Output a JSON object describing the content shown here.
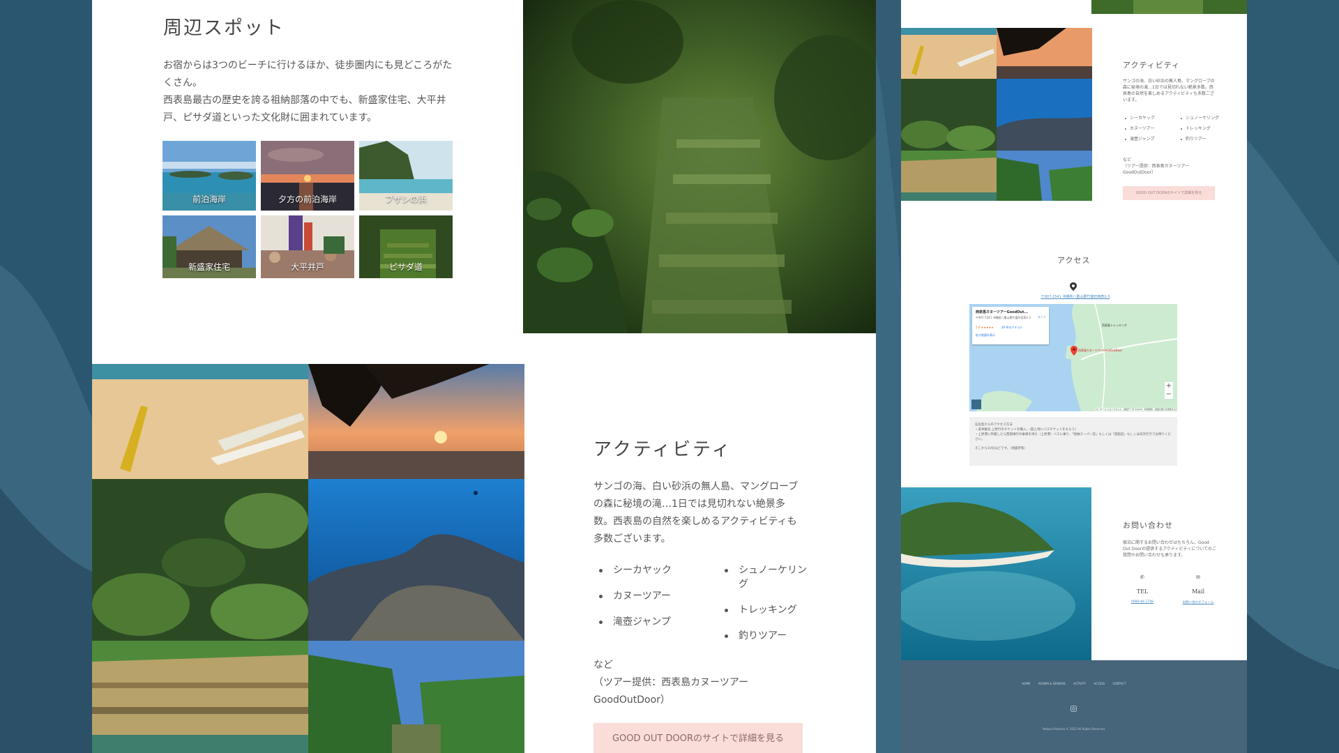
{
  "left": {
    "spots": {
      "title": "周辺スポット",
      "text1": "お宿からは3つのビーチに行けるほか、徒歩圏内にも見どころがたくさん。",
      "text2": "西表島最古の歴史を誇る祖納部落の中でも、新盛家住宅、大平井戸、ピサダ道といった文化財に囲まれています。",
      "thumbs": [
        "前泊海岸",
        "夕方の前泊海岸",
        "ブザシの浜",
        "新盛家住宅",
        "大平井戸",
        "ピサダ道"
      ]
    },
    "activity": {
      "title": "アクティビティ",
      "text": "サンゴの海、白い砂浜の無人島、マングローブの森に秘境の滝…1日では見切れない絶景多数。西表島の自然を楽しめるアクティビティも多数ございます。",
      "list_left": [
        "シーカヤック",
        "カヌーツアー",
        "滝壺ジャンプ"
      ],
      "list_right": [
        "シュノーケリング",
        "トレッキング",
        "釣りツアー"
      ],
      "note1": "など",
      "note2": "（ツアー提供：西表島カヌーツアーGoodOutDoor）",
      "button": "GOOD OUT DOORのサイトで詳細を見る"
    }
  },
  "right": {
    "activity": {
      "title": "アクティビティ",
      "text": "サンゴの海、白い砂浜の無人島、マングローブの森に秘境の滝…1日では見切れない絶景多数。西表島の自然を楽しめるアクティビティも多数ございます。",
      "list_left": [
        "シーカヤック",
        "カヌーツアー",
        "滝壺ジャンプ"
      ],
      "list_right": [
        "シュノーケリング",
        "トレッキング",
        "釣りツアー"
      ],
      "note1": "など",
      "note2": "（ツアー提供：西表島カヌーツアーGoodOutDoor）",
      "button": "GOOD OUT DOORのサイトで詳細を見る"
    },
    "access": {
      "title": "アクセス",
      "address_link": "〒907-1541 沖縄県八重山郡竹富町西表2-3",
      "map_card_title": "西表島カヌーツアーGoodOut...",
      "map_card_addr": "〒907-1541 沖縄県八重山郡竹富町西表2-3",
      "map_card_rating": "5.0 ★★★★★",
      "map_card_reviews": "26 件のクチコミ",
      "map_card_link": "拡大地図を表示",
      "map_card_route": "ルート",
      "map_label_1": "西表島カヌーツアーGoodOutDoor",
      "map_label_2": "西表島トレッキング",
      "map_footer": "キーボード ショートカット　地図データ ©2023　利用規約　地図の誤りを報告する",
      "info_lines": [
        "石垣島からのアクセス方法",
        "・安栄観光 上原行のチケットを購入。（船上待にバスチケットをもらう）",
        "・上原港に到着したら西部線行の乗車を待ち（上原港）バスに乗り、「祖納スーパー前」もしくは「旅館前」もしくは白浜行きでお降りください。",
        "そこから10分ほどです。（地図参照）"
      ]
    },
    "contact": {
      "title": "お問い合わせ",
      "text": "宿泊に関するお問い合わせはもちろん、Good Out Doorの提供するアクティビティについてのご質問やお問い合わせも承ります。",
      "tel_label": "TEL",
      "tel_value": "0980-84-1798",
      "mail_label": "Mail",
      "mail_value": "お問い合わせフォーム"
    },
    "footer": {
      "nav": [
        "HOME",
        "ROOMS & RESERVE",
        "ACTIVITY",
        "ACCESS",
        "CONTACT"
      ],
      "copyright": "Yadoya Poeloma © 2023 All Rights Reserved."
    }
  }
}
